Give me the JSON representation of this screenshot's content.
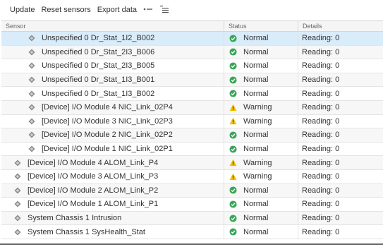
{
  "toolbar": {
    "update": "Update",
    "reset_sensors": "Reset sensors",
    "export_data": "Export data",
    "expand_icon": "expand-all-icon",
    "collapse_icon": "collapse-list-icon"
  },
  "columns": {
    "sensor": "Sensor",
    "status": "Status",
    "details": "Details"
  },
  "colors": {
    "normal": "#3aa55a",
    "warning": "#f2c200",
    "selected_row": "#d9ecfa"
  },
  "rows": [
    {
      "sensor": "Unspecified 0 Dr_Stat_1I2_B002",
      "status": "Normal",
      "details": "Reading: 0"
    },
    {
      "sensor": "Unspecified 0 Dr_Stat_2I3_B006",
      "status": "Normal",
      "details": "Reading: 0"
    },
    {
      "sensor": "Unspecified 0 Dr_Stat_2I3_B005",
      "status": "Normal",
      "details": "Reading: 0"
    },
    {
      "sensor": "Unspecified 0 Dr_Stat_1I3_B001",
      "status": "Normal",
      "details": "Reading: 0"
    },
    {
      "sensor": "Unspecified 0 Dr_Stat_1I3_B002",
      "status": "Normal",
      "details": "Reading: 0"
    },
    {
      "sensor": "[Device] I/O Module 4 NIC_Link_02P4",
      "status": "Warning",
      "details": "Reading: 0"
    },
    {
      "sensor": "[Device] I/O Module 3 NIC_Link_02P3",
      "status": "Warning",
      "details": "Reading: 0"
    },
    {
      "sensor": "[Device] I/O Module 2 NIC_Link_02P2",
      "status": "Normal",
      "details": "Reading: 0"
    },
    {
      "sensor": "[Device] I/O Module 1 NIC_Link_02P1",
      "status": "Normal",
      "details": "Reading: 0"
    },
    {
      "sensor": "[Device] I/O Module 4 ALOM_Link_P4",
      "status": "Warning",
      "details": "Reading: 0"
    },
    {
      "sensor": "[Device] I/O Module 3 ALOM_Link_P3",
      "status": "Warning",
      "details": "Reading: 0"
    },
    {
      "sensor": "[Device] I/O Module 2 ALOM_Link_P2",
      "status": "Normal",
      "details": "Reading: 0"
    },
    {
      "sensor": "[Device] I/O Module 1 ALOM_Link_P1",
      "status": "Normal",
      "details": "Reading: 0"
    },
    {
      "sensor": "System Chassis 1 Intrusion",
      "status": "Normal",
      "details": "Reading: 0"
    },
    {
      "sensor": "System Chassis 1 SysHealth_Stat",
      "status": "Normal",
      "details": "Reading: 0"
    }
  ]
}
